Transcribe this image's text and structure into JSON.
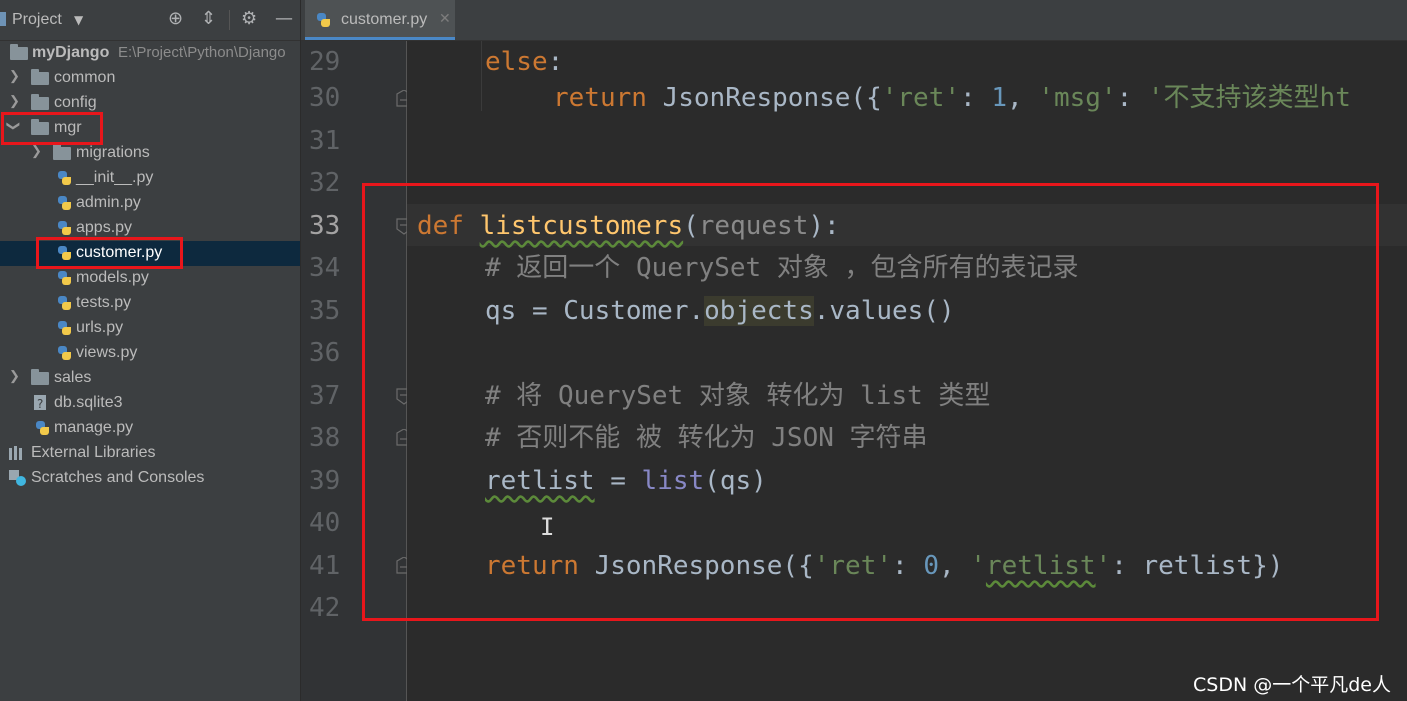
{
  "project_header": {
    "title": "Project"
  },
  "tree": {
    "root": {
      "name": "myDjango",
      "path": "E:\\Project\\Python\\Django"
    },
    "items": [
      {
        "label": "common"
      },
      {
        "label": "config"
      },
      {
        "label": "mgr"
      },
      {
        "label": "migrations"
      },
      {
        "label": "__init__.py"
      },
      {
        "label": "admin.py"
      },
      {
        "label": "apps.py"
      },
      {
        "label": "customer.py"
      },
      {
        "label": "models.py"
      },
      {
        "label": "tests.py"
      },
      {
        "label": "urls.py"
      },
      {
        "label": "views.py"
      },
      {
        "label": "sales"
      },
      {
        "label": "db.sqlite3"
      },
      {
        "label": "manage.py"
      },
      {
        "label": "External Libraries"
      },
      {
        "label": "Scratches and Consoles"
      }
    ]
  },
  "editor": {
    "tab_label": "customer.py",
    "line_numbers": [
      "29",
      "30",
      "31",
      "32",
      "33",
      "34",
      "35",
      "36",
      "37",
      "38",
      "39",
      "40",
      "41",
      "42"
    ],
    "active_line": "33",
    "code": {
      "l29_else": "else",
      "l29_colon": ":",
      "l30_return": "return",
      "l30_rest": " JsonResponse({",
      "l30_s1": "'ret'",
      "l30_c1": ": ",
      "l30_n1": "1",
      "l30_c2": ", ",
      "l30_s2": "'msg'",
      "l30_c3": ": ",
      "l30_s3": "'不支持该类型ht",
      "l33_def": "def",
      "l33_name": "listcustomers",
      "l33_open": "(",
      "l33_param": "request",
      "l33_close": "):",
      "l34_comment": "# 返回一个 QuerySet 对象 ，包含所有的表记录",
      "l35_a": "qs = Customer.",
      "l35_obj": "objects",
      "l35_b": ".values()",
      "l37_comment": "# 将 QuerySet 对象 转化为 list 类型",
      "l38_comment": "# 否则不能 被 转化为 JSON 字符串",
      "l39_var": "retlist",
      "l39_eq": " = ",
      "l39_list": "list",
      "l39_rest": "(qs)",
      "l41_return": "return",
      "l41_a": " JsonResponse({",
      "l41_s1": "'ret'",
      "l41_b": ": ",
      "l41_n": "0",
      "l41_c": ", ",
      "l41_s2a": "'",
      "l41_s2": "retlist",
      "l41_s2b": "'",
      "l41_d": ": retlist})"
    }
  },
  "watermark": "CSDN @一个平凡de人"
}
